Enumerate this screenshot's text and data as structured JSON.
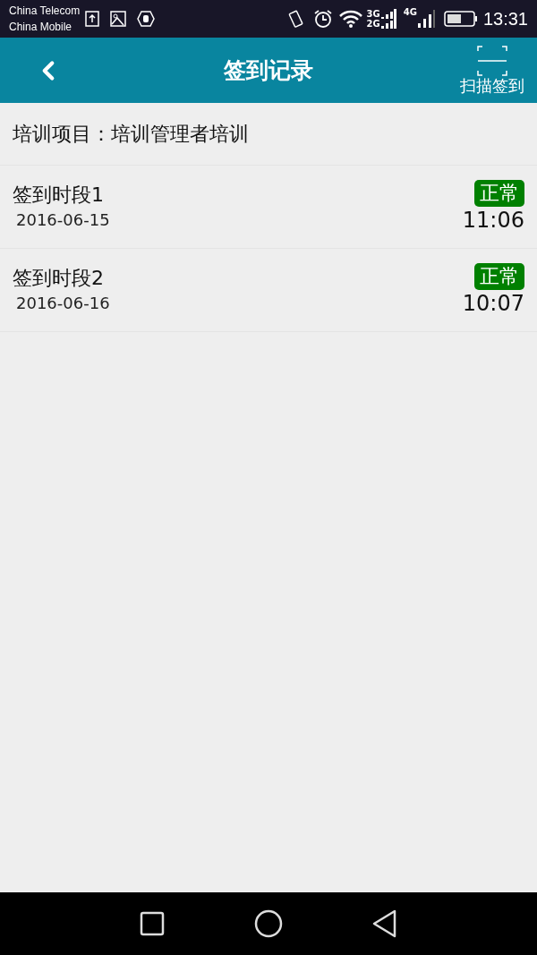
{
  "status_bar": {
    "carriers": [
      "China Telecom",
      "China Mobile"
    ],
    "network_3g": "3G",
    "network_2g": "2G",
    "network_4g": "4G",
    "time": "13:31"
  },
  "header": {
    "title": "签到记录",
    "scan_label": "扫描签到"
  },
  "project": {
    "label": "培训项目：培训管理者培训"
  },
  "records": [
    {
      "name": "签到时段1",
      "date": "2016-06-15",
      "status": "正常",
      "color": "#008000",
      "time": "11:06"
    },
    {
      "name": "签到时段2",
      "date": "2016-06-16",
      "status": "正常",
      "color": "#008000",
      "time": "10:07"
    }
  ]
}
